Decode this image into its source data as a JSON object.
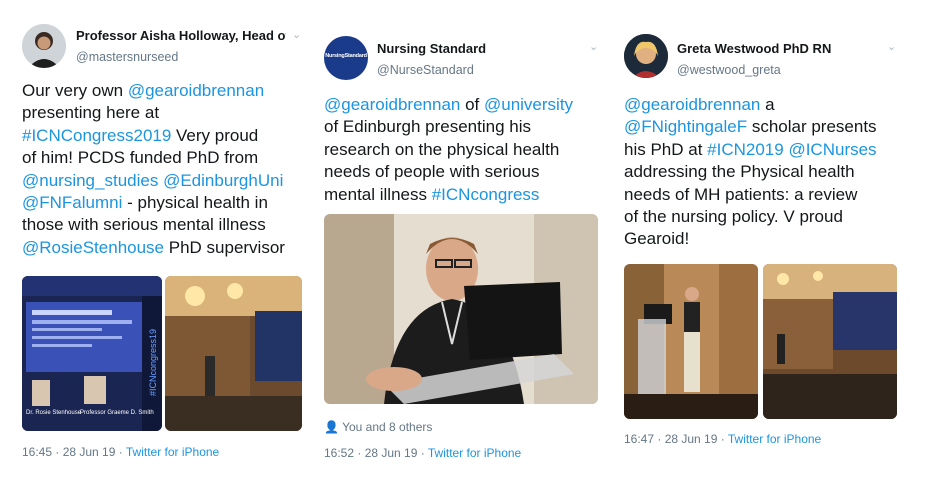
{
  "tweets": [
    {
      "author": "Professor Aisha Holloway, Head of ...",
      "handle": "@mastersnurseed",
      "text": {
        "l1a": "Our very own ",
        "l1b": "@gearoidbrennan",
        "l2": "presenting here at",
        "l3a": "#ICNCongress2019",
        "l3b": " Very proud",
        "l4": "of him! PCDS funded PhD from",
        "l5a": "@nursing_studies",
        "l5b": " ",
        "l5c": "@EdinburghUni",
        "l6a": "@FNFalumni",
        "l6b": " - physical health in",
        "l7": "those with serious mental illness",
        "l8a": "@RosieStenhouse",
        "l8b": " PhD supervisor"
      },
      "slide_name_left": "Dr. Rosie Stenhouse",
      "slide_name_right": "Professor Graeme D. Smith",
      "slide_banner": "#ICNcongress19",
      "time": "16:45 · 28 Jun 19 ·",
      "source": "Twitter for iPhone"
    },
    {
      "author": "Nursing Standard",
      "handle": "@NurseStandard",
      "logo_text": "NursingStandard",
      "text": {
        "l1a": "@gearoidbrennan",
        "l1b": " of ",
        "l1c": "@university",
        "l2": "of Edinburgh presenting his",
        "l3": "research on the physical health",
        "l4": "needs of people with serious",
        "l5a": "mental illness ",
        "l5b": "#ICNcongress"
      },
      "likes": "You and 8 others",
      "time": "16:52 · 28 Jun 19 ·",
      "source": "Twitter for iPhone"
    },
    {
      "author": "Greta Westwood PhD RN",
      "handle": "@westwood_greta",
      "text": {
        "l1a": "@gearoidbrennan",
        "l1b": " a",
        "l2a": "@FNightingaleF",
        "l2b": " scholar presents",
        "l3a": "his PhD at ",
        "l3b": "#ICN2019",
        "l3c": " ",
        "l3d": "@ICNurses",
        "l4": "addressing the Physical health",
        "l5": "needs of MH patients: a review",
        "l6": "of the nursing policy. V proud",
        "l7": "Gearoid!"
      },
      "time": "16:47 · 28 Jun 19 ·",
      "source": "Twitter for iPhone"
    }
  ],
  "icons": {
    "chevron": "chevron-down-icon",
    "like": "person-icon"
  },
  "colors": {
    "link": "#1b95e0",
    "muted": "#657786",
    "text": "#14171a",
    "nursing_standard_logo": "#1a3a8a"
  }
}
